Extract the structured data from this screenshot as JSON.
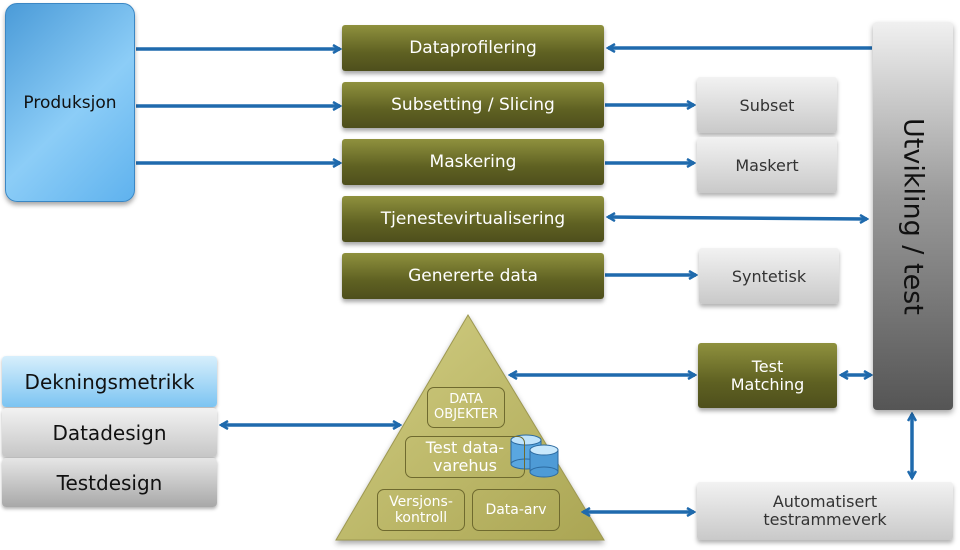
{
  "source": {
    "label": "Produksjon"
  },
  "processes": [
    {
      "label": "Dataprofilering"
    },
    {
      "label": "Subsetting / Slicing"
    },
    {
      "label": "Maskering"
    },
    {
      "label": "Tjenestevirtualisering"
    },
    {
      "label": "Genererte data"
    }
  ],
  "outputs": [
    {
      "label": "Subset"
    },
    {
      "label": "Maskert"
    },
    {
      "label": "Syntetisk"
    }
  ],
  "target": {
    "label": "Utvikling / test"
  },
  "matching": {
    "label": "Test Matching"
  },
  "framework": {
    "label": "Automatisert testrammeverk"
  },
  "design_stack": [
    {
      "label": "Dekningsmetrikk"
    },
    {
      "label": "Datadesign"
    },
    {
      "label": "Testdesign"
    }
  ],
  "pyramid": {
    "top": "DATA OBJEKTER",
    "middle": "Test data-varehus",
    "bottom_left": "Versjons-kontroll",
    "bottom_right": "Data-arv",
    "icon": "database-icon"
  },
  "colors": {
    "arrow": "#1f6aad",
    "olive": "#6b6d2a",
    "pyramid": "#c2bd6a",
    "blue": "#6cbcf2"
  }
}
